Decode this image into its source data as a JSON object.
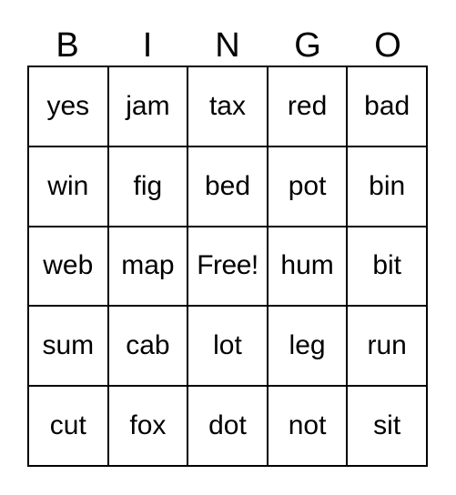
{
  "card": {
    "title": "BINGO",
    "columns": [
      "B",
      "I",
      "N",
      "G",
      "O"
    ],
    "free_space_label": "Free!",
    "colors": {
      "background": "#ffffff",
      "border": "#000000",
      "text": "#000000"
    },
    "rows": [
      {
        "cells": [
          "yes",
          "jam",
          "tax",
          "red",
          "bad"
        ]
      },
      {
        "cells": [
          "win",
          "fig",
          "bed",
          "pot",
          "bin"
        ]
      },
      {
        "cells": [
          "web",
          "map",
          "Free!",
          "hum",
          "bit"
        ]
      },
      {
        "cells": [
          "sum",
          "cab",
          "lot",
          "leg",
          "run"
        ]
      },
      {
        "cells": [
          "cut",
          "fox",
          "dot",
          "not",
          "sit"
        ]
      }
    ]
  }
}
